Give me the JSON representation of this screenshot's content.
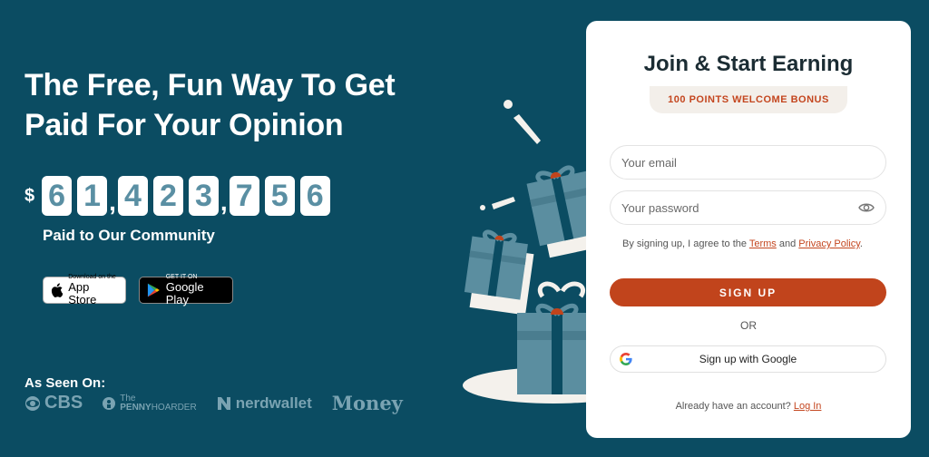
{
  "hero": {
    "title_line1": "The Free, Fun Way To Get",
    "title_line2": "Paid For Your Opinion"
  },
  "counter": {
    "currency": "$",
    "groups": [
      [
        "6",
        "1"
      ],
      [
        "4",
        "2",
        "3"
      ],
      [
        "7",
        "5",
        "6"
      ]
    ],
    "separator": ",",
    "value": "61,423,756",
    "label": "Paid to Our Community"
  },
  "app_badges": {
    "apple": {
      "small": "Download on the",
      "big": "App Store",
      "icon": "apple-icon"
    },
    "google": {
      "small": "GET IT ON",
      "big": "Google Play",
      "icon": "google-play-icon"
    }
  },
  "press": {
    "heading": "As Seen On:",
    "logos": [
      {
        "name": "CBS",
        "icon": "cbs-eye-icon"
      },
      {
        "name_small": "The",
        "name_bold": "PENNY",
        "name_rest": "HOARDER",
        "icon": "penny-icon"
      },
      {
        "name": "nerdwallet",
        "icon": "nerdwallet-n-icon"
      },
      {
        "name": "Money"
      }
    ]
  },
  "signup_card": {
    "title": "Join & Start Earning",
    "bonus": "100 POINTS WELCOME BONUS",
    "email_placeholder": "Your email",
    "password_placeholder": "Your password",
    "terms_prefix": "By signing up, I agree to the ",
    "terms_link": "Terms",
    "terms_and": " and ",
    "privacy_link": "Privacy Policy",
    "terms_suffix": ".",
    "signup_button": "SIGN UP",
    "or_label": "OR",
    "google_button": "Sign up with Google",
    "login_prompt": "Already have an account? ",
    "login_link": "Log In"
  },
  "colors": {
    "background": "#0b4c62",
    "accent": "#c1441c",
    "digit_text": "#5a8fa3",
    "bonus_bg": "#f3efea"
  }
}
